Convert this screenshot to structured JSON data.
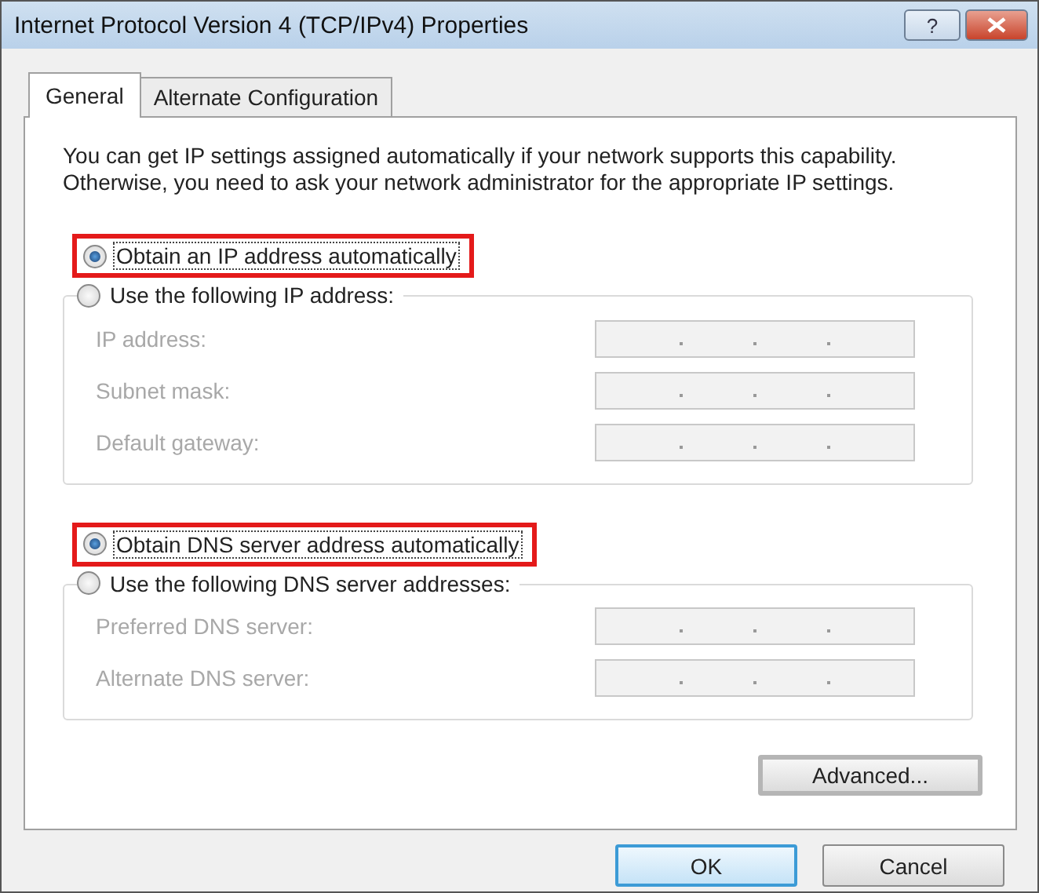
{
  "window": {
    "title": "Internet Protocol Version 4 (TCP/IPv4) Properties"
  },
  "title_buttons": [
    {
      "kind": "help",
      "label": "?"
    },
    {
      "kind": "close"
    }
  ],
  "tabs": [
    {
      "label": "General",
      "selected": true
    },
    {
      "label": "Alternate Configuration",
      "selected": false
    }
  ],
  "intro": "You can get IP settings assigned automatically if your network supports this capability. Otherwise, you need to ask your network administrator for the appropriate IP settings.",
  "groups": [
    {
      "options": [
        {
          "label": "Obtain an IP address automatically",
          "selected": true,
          "highlighted": true
        },
        {
          "label": "Use the following IP address:",
          "selected": false,
          "highlighted": false
        }
      ],
      "fields": [
        {
          "label": "IP address:",
          "disabled": true
        },
        {
          "label": "Subnet mask:",
          "disabled": true
        },
        {
          "label": "Default gateway:",
          "disabled": true
        }
      ]
    },
    {
      "options": [
        {
          "label": "Obtain DNS server address automatically",
          "selected": true,
          "highlighted": true
        },
        {
          "label": "Use the following DNS server addresses:",
          "selected": false,
          "highlighted": false
        }
      ],
      "fields": [
        {
          "label": "Preferred DNS server:",
          "disabled": true
        },
        {
          "label": "Alternate DNS server:",
          "disabled": true
        }
      ]
    }
  ],
  "advanced_button": "Advanced...",
  "buttons": [
    {
      "label": "OK",
      "default": true
    },
    {
      "label": "Cancel",
      "default": false
    }
  ]
}
